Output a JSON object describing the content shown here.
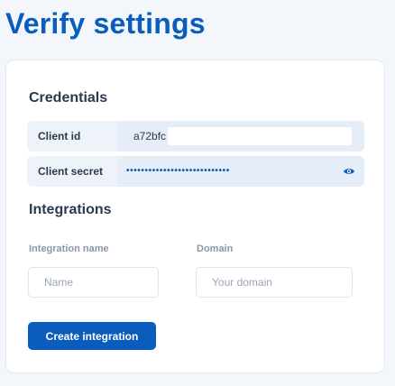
{
  "page": {
    "title": "Verify settings"
  },
  "credentials": {
    "heading": "Credentials",
    "client_id": {
      "label": "Client id",
      "value": "a72bfc"
    },
    "client_secret": {
      "label": "Client secret",
      "masked_value": "••••••••••••••••••••••••••••",
      "toggle_icon": "eye-icon"
    }
  },
  "integrations": {
    "heading": "Integrations",
    "name_field": {
      "label": "Integration name",
      "value": "",
      "placeholder": "Name"
    },
    "domain_field": {
      "label": "Domain",
      "value": "",
      "placeholder": "Your domain"
    },
    "create_button_label": "Create integration"
  },
  "colors": {
    "accent": "#0a5dbd",
    "background": "#f3f6fa",
    "card": "#ffffff",
    "text": "#2b3a4d",
    "muted": "#8a97a8"
  }
}
